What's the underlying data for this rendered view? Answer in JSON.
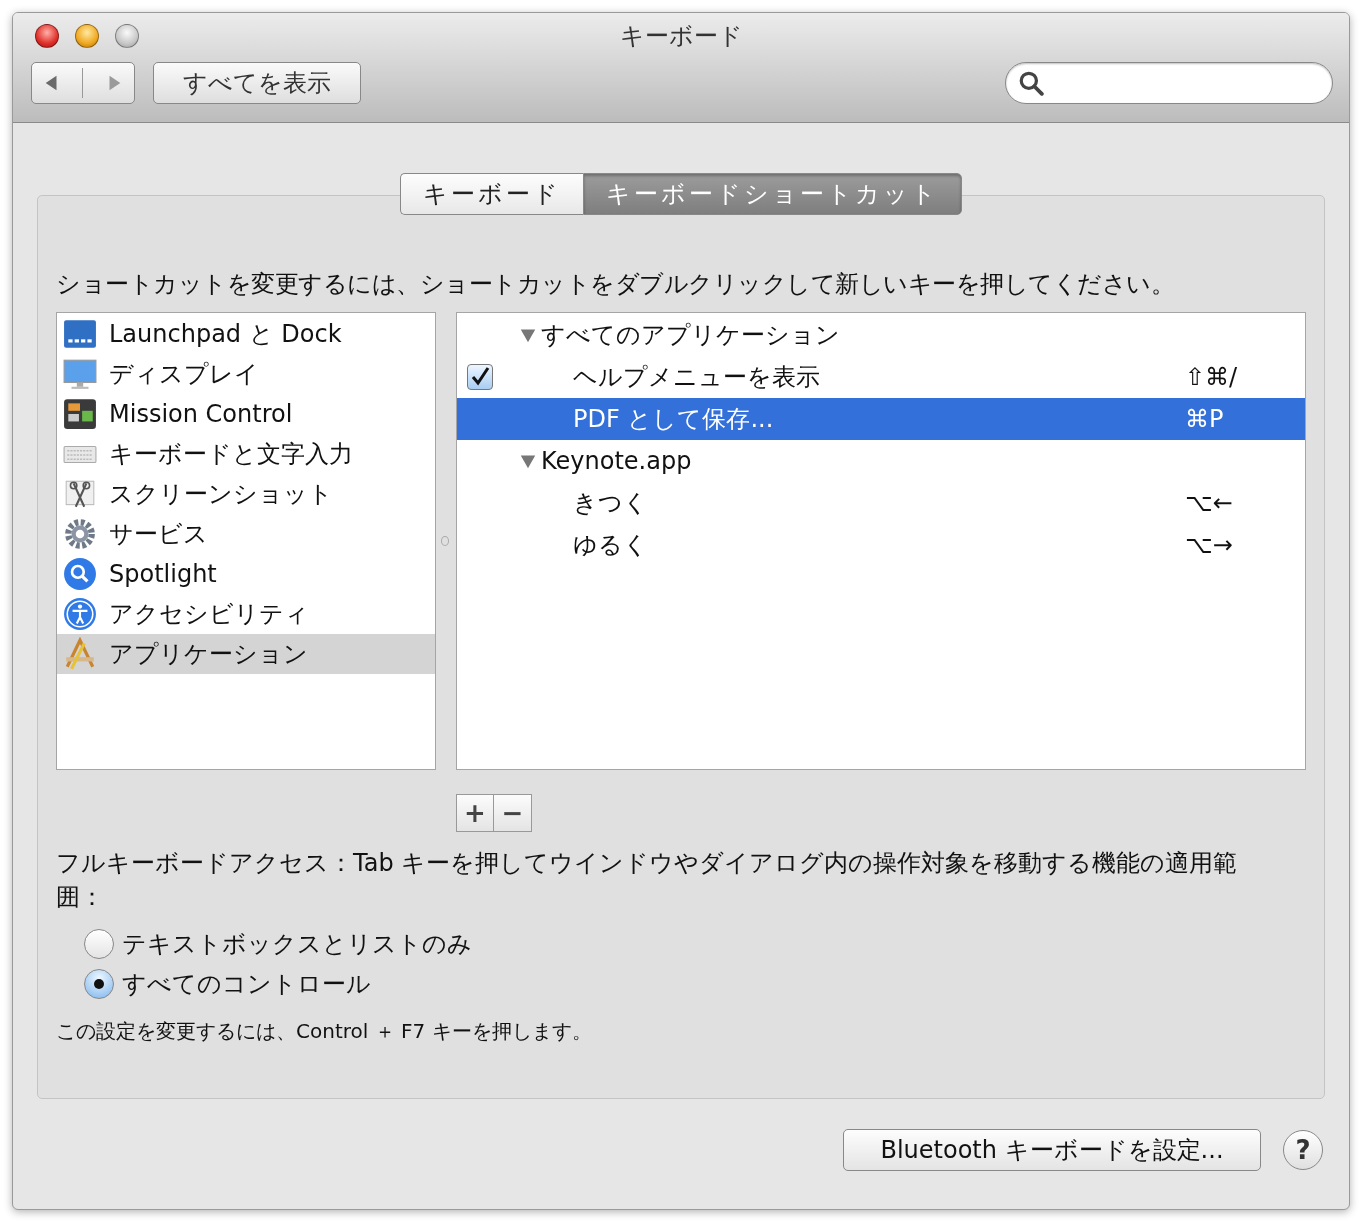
{
  "window": {
    "title": "キーボード"
  },
  "toolbar": {
    "show_all": "すべてを表示"
  },
  "tabs": [
    {
      "label": "キーボード",
      "selected": false
    },
    {
      "label": "キーボードショートカット",
      "selected": true
    }
  ],
  "instruction": "ショートカットを変更するには、ショートカットをダブルクリックして新しいキーを押してください。",
  "categories": [
    {
      "label": "Launchpad と Dock",
      "selected": false
    },
    {
      "label": "ディスプレイ",
      "selected": false
    },
    {
      "label": "Mission Control",
      "selected": false
    },
    {
      "label": "キーボードと文字入力",
      "selected": false
    },
    {
      "label": "スクリーンショット",
      "selected": false
    },
    {
      "label": "サービス",
      "selected": false
    },
    {
      "label": "Spotlight",
      "selected": false
    },
    {
      "label": "アクセシビリティ",
      "selected": false
    },
    {
      "label": "アプリケーション",
      "selected": true
    }
  ],
  "shortcuts": [
    {
      "label": "すべてのアプリケーション",
      "expanded": true,
      "children": [
        {
          "label": "ヘルプメニューを表示",
          "shortcut": "⇧⌘/",
          "checked": true,
          "selected": false
        },
        {
          "label": "PDF として保存...",
          "shortcut": "⌘P",
          "selected": true
        }
      ]
    },
    {
      "label": "Keynote.app",
      "expanded": true,
      "children": [
        {
          "label": "きつく",
          "shortcut": "⌥←",
          "selected": false
        },
        {
          "label": "ゆるく",
          "shortcut": "⌥→",
          "selected": false
        }
      ]
    }
  ],
  "list_buttons": [
    "+",
    "−"
  ],
  "full_keyboard_access": {
    "label": "フルキーボードアクセス：Tab キーを押してウインドウやダイアログ内の操作対象を移動する機能の適用範囲：",
    "options": [
      {
        "label": "テキストボックスとリストのみ",
        "selected": false
      },
      {
        "label": "すべてのコントロール",
        "selected": true
      }
    ],
    "hint": "この設定を変更するには、Control ＋ F7 キーを押します。"
  },
  "bluetooth_button": "Bluetooth キーボードを設定...",
  "help_button": "?"
}
